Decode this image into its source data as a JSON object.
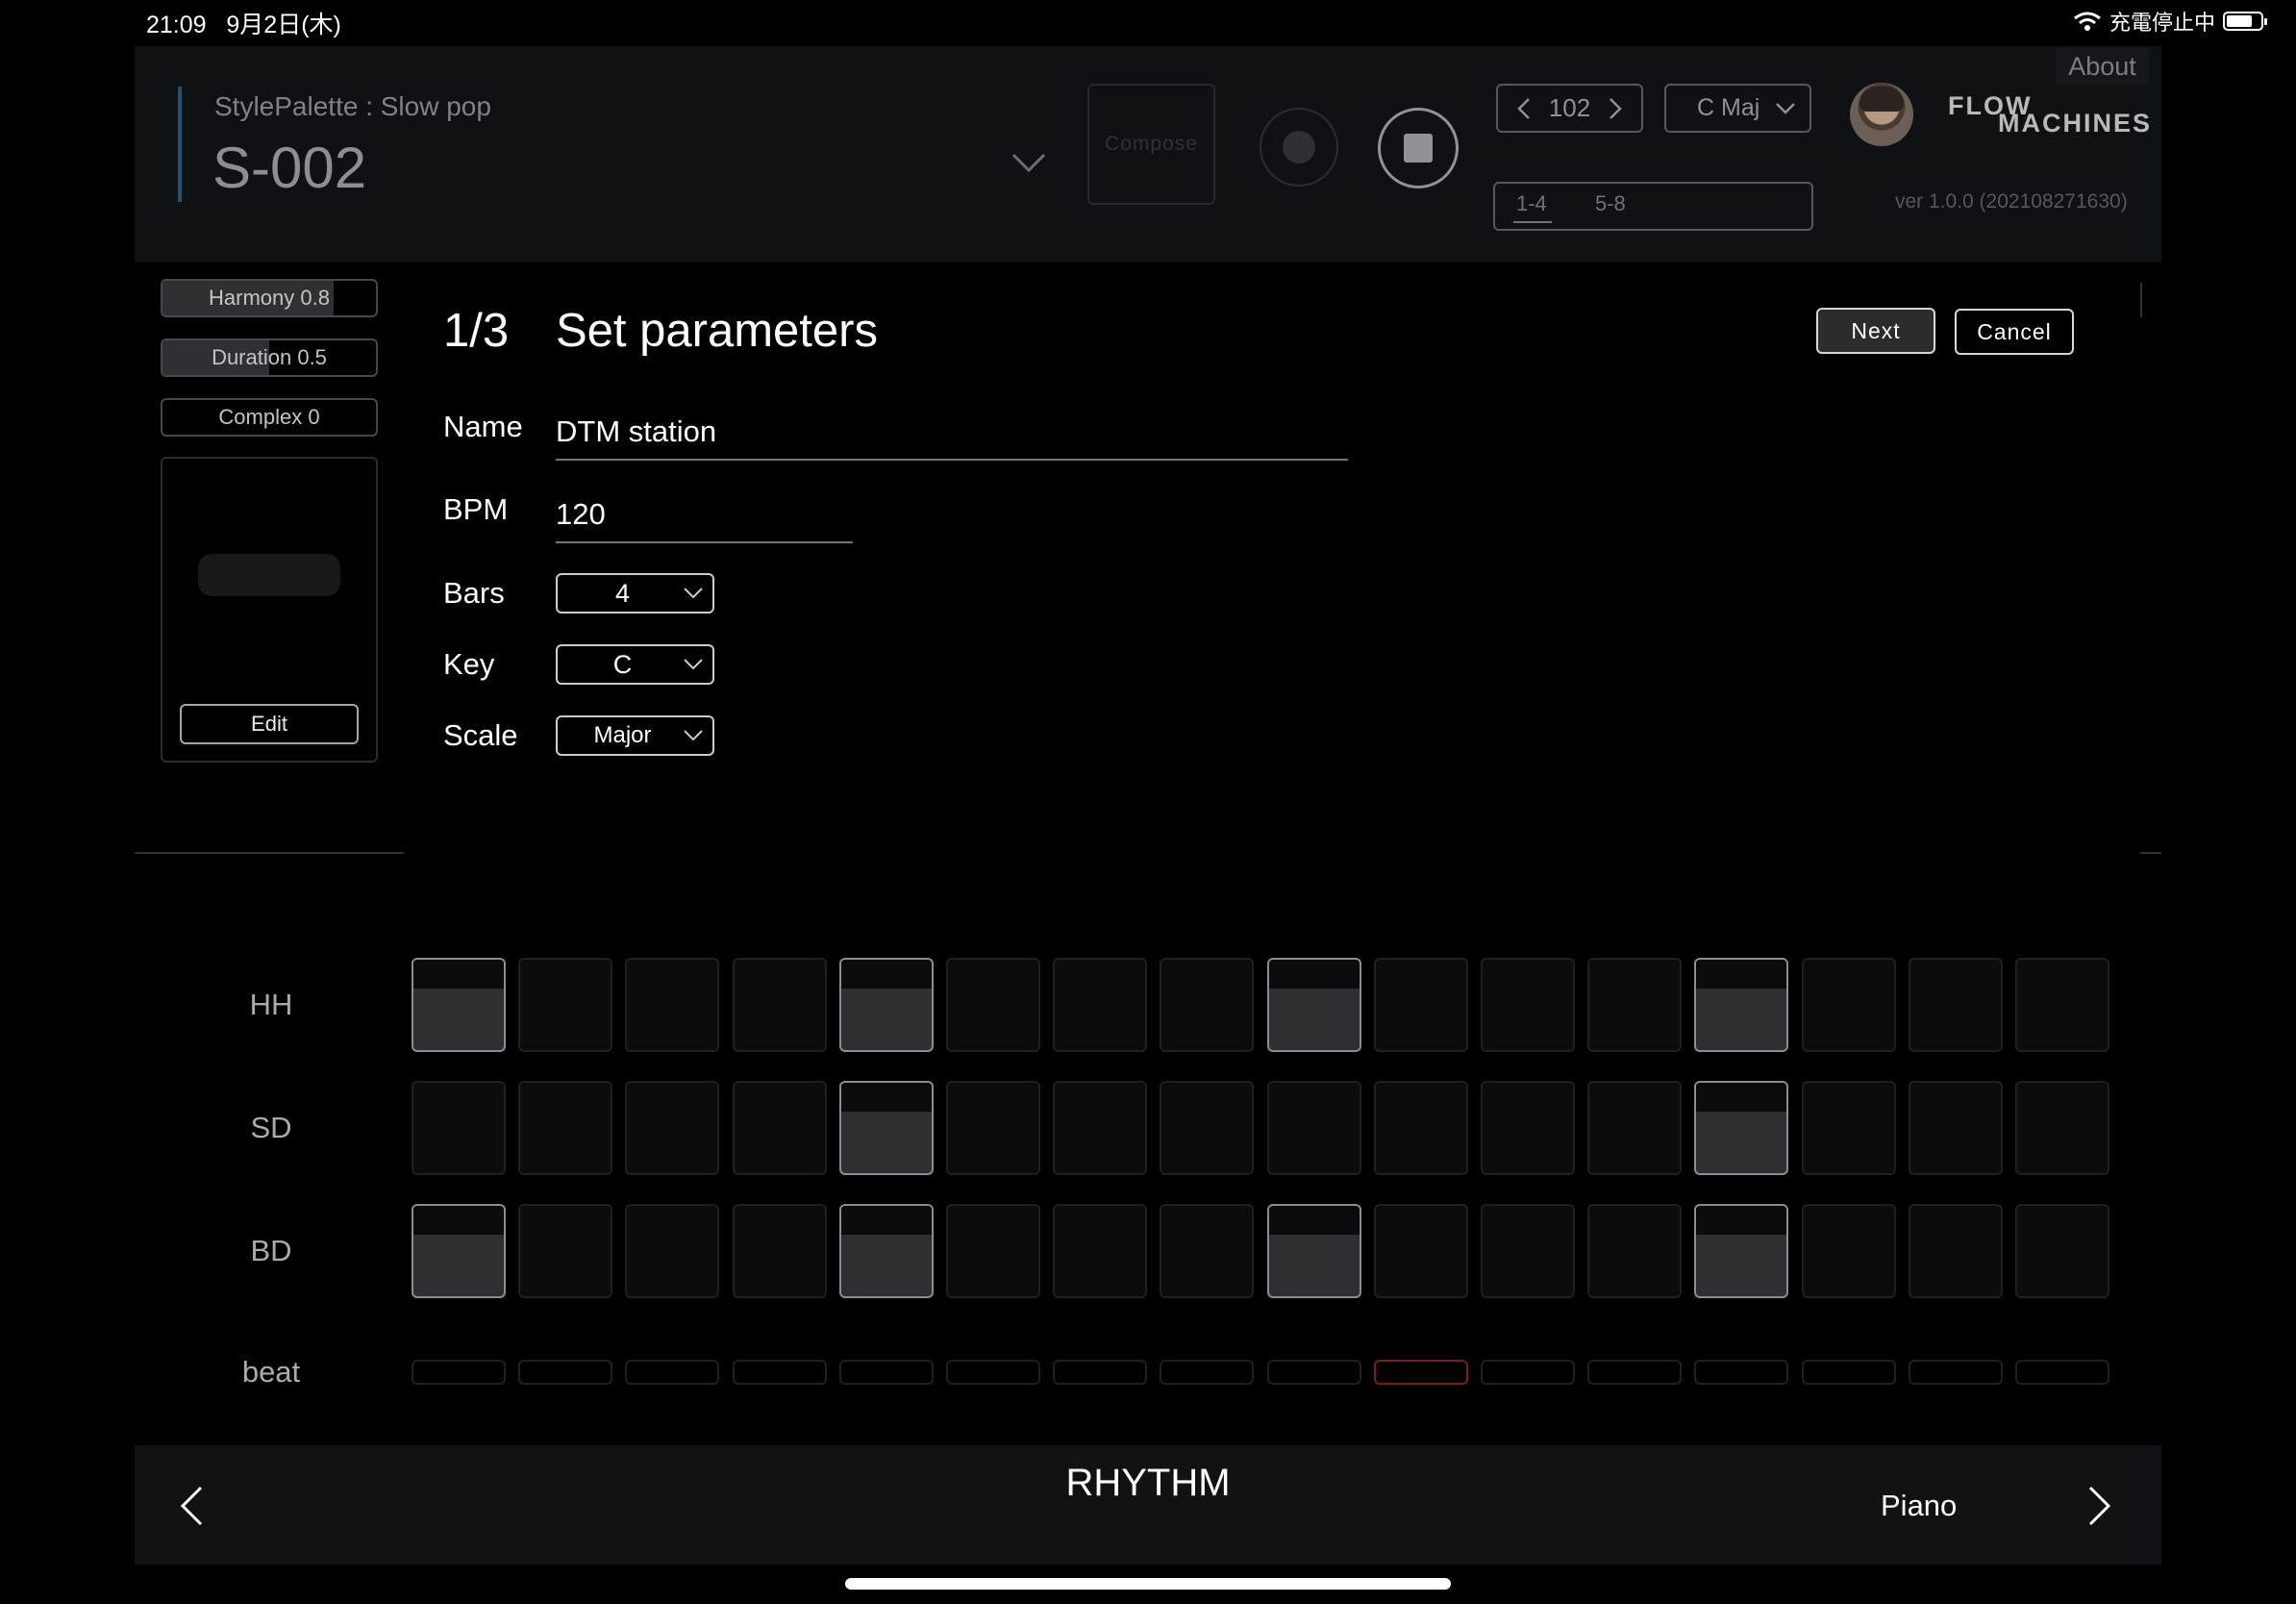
{
  "status_bar": {
    "time": "21:09",
    "date": "9月2日(木)",
    "charging": "充電停止中"
  },
  "header": {
    "style_palette": "StylePalette : Slow pop",
    "style_name": "S-002",
    "compose_label": "Compose",
    "tempo": "102",
    "key": "C Maj",
    "about_label": "About",
    "logo_line1": "FLOW",
    "logo_line2": "MACHINES",
    "sections": [
      "1-4",
      "5-8"
    ],
    "version": "ver 1.0.0 (202108271630)"
  },
  "params": [
    {
      "label": "Harmony  0.8",
      "level": 0.8
    },
    {
      "label": "Duration 0.5",
      "level": 0.5
    },
    {
      "label": "Complex 0",
      "level": 0
    }
  ],
  "edit_label": "Edit",
  "modal": {
    "step": "1/3",
    "title": "Set parameters",
    "next_label": "Next",
    "cancel_label": "Cancel",
    "name_label": "Name",
    "name_value": "DTM station",
    "bpm_label": "BPM",
    "bpm_value": "120",
    "bars_label": "Bars",
    "bars_value": "4",
    "key_label": "Key",
    "key_value": "C",
    "scale_label": "Scale",
    "scale_value": "Major"
  },
  "rhythm": {
    "rows": [
      {
        "label": "HH",
        "active": [
          0,
          4,
          8,
          12
        ]
      },
      {
        "label": "SD",
        "active": [
          4,
          12
        ]
      },
      {
        "label": "BD",
        "active": [
          0,
          4,
          8,
          12
        ]
      }
    ],
    "steps": 16,
    "beat_label": "beat",
    "current_beat": 9
  },
  "bottom": {
    "title": "RHYTHM",
    "next_page": "Piano"
  },
  "colors": {
    "background": "#000000",
    "panel": "#0f1215",
    "beat_marker": "#7a1f1a"
  }
}
